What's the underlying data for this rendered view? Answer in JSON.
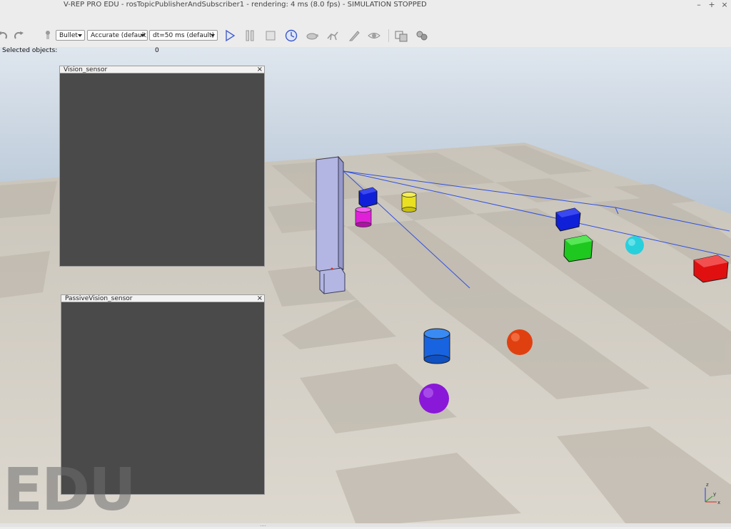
{
  "window": {
    "title": "V-REP PRO EDU - rosTopicPublisherAndSubscriber1 - rendering: 4 ms (8.0 fps) - SIMULATION STOPPED",
    "minimize": "–",
    "maximize": "+",
    "close": "×"
  },
  "toolbar": {
    "engine_select": "Bullet",
    "accuracy_select": "Accurate (default)",
    "dt_select": "dt=50 ms (default)",
    "icons": [
      "undo-icon",
      "redo-icon",
      "pointer-icon",
      "play-icon",
      "pause-icon",
      "stop-icon",
      "realtime-icon",
      "slow-down-icon",
      "speed-up-icon",
      "thread-rendering-icon",
      "visualization-icon",
      "page-selector-icon",
      "scene-selector-icon"
    ]
  },
  "info": {
    "selected_label": "Selected objects:",
    "selected_count": "0"
  },
  "sensors": [
    {
      "title": "Vision_sensor"
    },
    {
      "title": "PassiveVision_sensor"
    }
  ],
  "watermark": "EDU",
  "axes": {
    "z": "z",
    "x": "x",
    "y": "y"
  },
  "colors": {
    "floor_light": "#dcd6cc",
    "floor_dark": "#b9b3a8",
    "sensor_body": "#b5b8e0",
    "red_cube": "#e01010",
    "green_cube": "#1ec81e",
    "blue_cube": "#1020d8",
    "cyan_sphere": "#28d0dc",
    "magenta_cylinder": "#e020d8",
    "yellow_cylinder": "#e8e020",
    "blue_cylinder": "#1864e0",
    "orange_sphere": "#e04010",
    "purple_sphere": "#8a18d8",
    "ray_color": "#3050e0"
  }
}
